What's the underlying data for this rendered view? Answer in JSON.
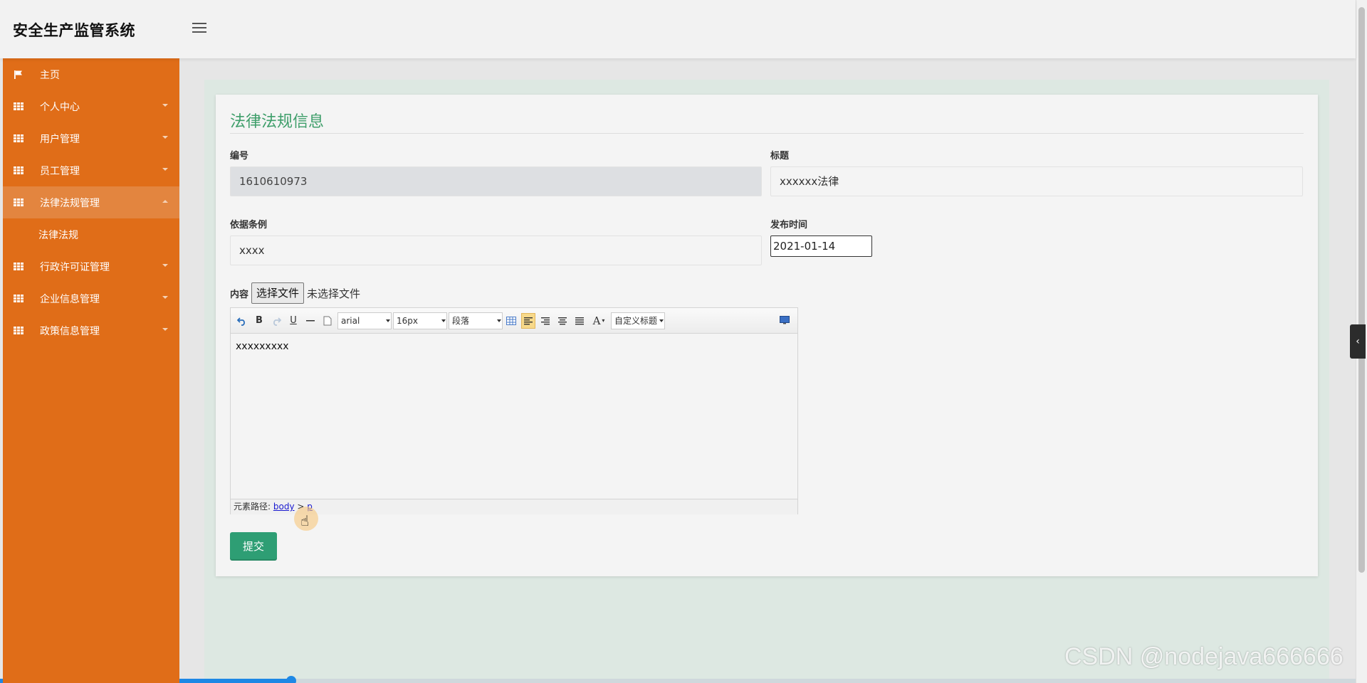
{
  "header": {
    "title": "安全生产监管系统",
    "avatar_text": "80x80"
  },
  "sidebar": {
    "items": [
      {
        "label": "主页",
        "icon": "flag-icon"
      },
      {
        "label": "个人中心",
        "icon": "grid-icon"
      },
      {
        "label": "用户管理",
        "icon": "grid-icon"
      },
      {
        "label": "员工管理",
        "icon": "grid-icon"
      },
      {
        "label": "法律法规管理",
        "icon": "grid-icon",
        "expanded": true
      },
      {
        "label": "行政许可证管理",
        "icon": "grid-icon"
      },
      {
        "label": "企业信息管理",
        "icon": "grid-icon"
      },
      {
        "label": "政策信息管理",
        "icon": "grid-icon"
      }
    ],
    "subitem": {
      "label": "法律法规"
    }
  },
  "form": {
    "title": "法律法规信息",
    "number_label": "编号",
    "number_value": "1610610973",
    "title_label": "标题",
    "title_value": "xxxxxx法律",
    "basis_label": "依据条例",
    "basis_value": "xxxx",
    "publish_label": "发布时间",
    "publish_value": "2021-01-14",
    "content_label": "内容",
    "file_button": "选择文件",
    "file_status": "未选择文件",
    "submit": "提交"
  },
  "editor": {
    "font_family": "arial",
    "font_size": "16px",
    "paragraph": "段落",
    "custom_title": "自定义标题",
    "body_text": "xxxxxxxxx",
    "path_label": "元素路径:",
    "path_body": "body",
    "path_sep": ">",
    "path_p": "p"
  },
  "video": {
    "progress": 0.215
  },
  "watermark": "CSDN @nodejava666666",
  "colors": {
    "sidebar": "#e06d18",
    "sidebar_active": "#e3853f",
    "accent_green": "#3e9e6a",
    "button_green": "#2e9e74",
    "main_bg": "#dde8e2"
  }
}
